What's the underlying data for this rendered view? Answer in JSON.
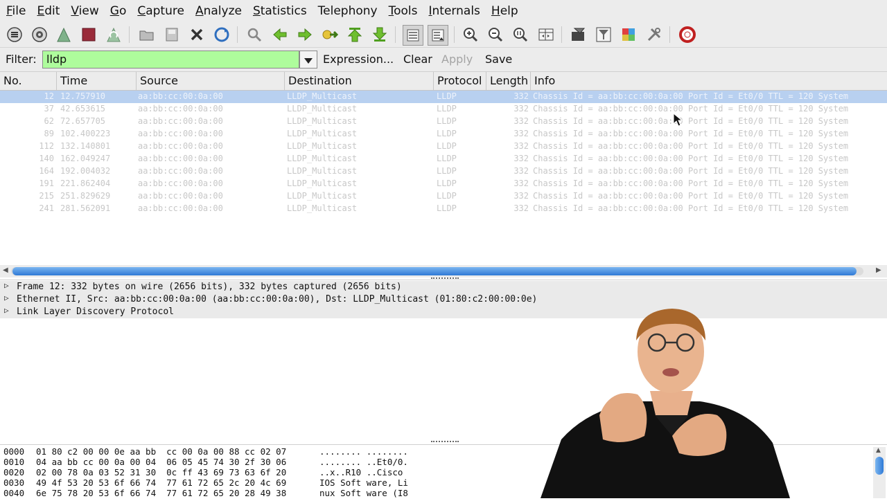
{
  "menu": [
    {
      "ul": "F",
      "rest": "ile"
    },
    {
      "ul": "E",
      "rest": "dit"
    },
    {
      "ul": "V",
      "rest": "iew"
    },
    {
      "ul": "G",
      "rest": "o"
    },
    {
      "ul": "C",
      "rest": "apture"
    },
    {
      "ul": "A",
      "rest": "nalyze"
    },
    {
      "ul": "S",
      "rest": "tatistics"
    },
    {
      "ul": "",
      "rest": "Telephony"
    },
    {
      "ul": "T",
      "rest": "ools"
    },
    {
      "ul": "I",
      "rest": "nternals"
    },
    {
      "ul": "H",
      "rest": "elp"
    }
  ],
  "toolbar": {
    "icons": [
      "interfaces-icon",
      "options-icon",
      "start-capture-icon",
      "stop-capture-icon",
      "restart-capture-icon",
      "open-file-icon",
      "save-file-icon",
      "close-file-icon",
      "reload-icon",
      "find-packet-icon",
      "go-back-icon",
      "go-forward-icon",
      "go-to-packet-icon",
      "go-first-icon",
      "go-last-icon",
      "colorize-icon",
      "auto-scroll-icon",
      "zoom-in-icon",
      "zoom-out-icon",
      "zoom-normal-icon",
      "resize-columns-icon",
      "capture-filters-icon",
      "display-filters-icon",
      "coloring-rules-icon",
      "preferences-icon",
      "help-icon"
    ]
  },
  "filter": {
    "label": "Filter:",
    "value": "lldp",
    "expression": "Expression...",
    "clear": "Clear",
    "apply": "Apply",
    "save": "Save"
  },
  "columns": [
    "No.",
    "Time",
    "Source",
    "Destination",
    "Protocol",
    "Length",
    "Info"
  ],
  "packets": [
    {
      "no": "12",
      "time": "12.757910",
      "src": "aa:bb:cc:00:0a:00",
      "dst": "LLDP_Multicast",
      "proto": "LLDP",
      "len": "332",
      "info": "Chassis Id = aa:bb:cc:00:0a:00 Port Id = Et0/0 TTL = 120 System",
      "selected": true
    },
    {
      "no": "37",
      "time": "42.653615",
      "src": "aa:bb:cc:00:0a:00",
      "dst": "LLDP_Multicast",
      "proto": "LLDP",
      "len": "332",
      "info": "Chassis Id = aa:bb:cc:00:0a:00 Port Id = Et0/0 TTL = 120 System"
    },
    {
      "no": "62",
      "time": "72.657705",
      "src": "aa:bb:cc:00:0a:00",
      "dst": "LLDP_Multicast",
      "proto": "LLDP",
      "len": "332",
      "info": "Chassis Id = aa:bb:cc:00:0a:00 Port Id = Et0/0 TTL = 120 System"
    },
    {
      "no": "89",
      "time": "102.400223",
      "src": "aa:bb:cc:00:0a:00",
      "dst": "LLDP_Multicast",
      "proto": "LLDP",
      "len": "332",
      "info": "Chassis Id = aa:bb:cc:00:0a:00 Port Id = Et0/0 TTL = 120 System"
    },
    {
      "no": "112",
      "time": "132.140801",
      "src": "aa:bb:cc:00:0a:00",
      "dst": "LLDP_Multicast",
      "proto": "LLDP",
      "len": "332",
      "info": "Chassis Id = aa:bb:cc:00:0a:00 Port Id = Et0/0 TTL = 120 System"
    },
    {
      "no": "140",
      "time": "162.049247",
      "src": "aa:bb:cc:00:0a:00",
      "dst": "LLDP_Multicast",
      "proto": "LLDP",
      "len": "332",
      "info": "Chassis Id = aa:bb:cc:00:0a:00 Port Id = Et0/0 TTL = 120 System"
    },
    {
      "no": "164",
      "time": "192.004032",
      "src": "aa:bb:cc:00:0a:00",
      "dst": "LLDP_Multicast",
      "proto": "LLDP",
      "len": "332",
      "info": "Chassis Id = aa:bb:cc:00:0a:00 Port Id = Et0/0 TTL = 120 System"
    },
    {
      "no": "191",
      "time": "221.862404",
      "src": "aa:bb:cc:00:0a:00",
      "dst": "LLDP_Multicast",
      "proto": "LLDP",
      "len": "332",
      "info": "Chassis Id = aa:bb:cc:00:0a:00 Port Id = Et0/0 TTL = 120 System"
    },
    {
      "no": "215",
      "time": "251.829629",
      "src": "aa:bb:cc:00:0a:00",
      "dst": "LLDP_Multicast",
      "proto": "LLDP",
      "len": "332",
      "info": "Chassis Id = aa:bb:cc:00:0a:00 Port Id = Et0/0 TTL = 120 System"
    },
    {
      "no": "241",
      "time": "281.562091",
      "src": "aa:bb:cc:00:0a:00",
      "dst": "LLDP_Multicast",
      "proto": "LLDP",
      "len": "332",
      "info": "Chassis Id = aa:bb:cc:00:0a:00 Port Id = Et0/0 TTL = 120 System"
    }
  ],
  "details": [
    "Frame 12: 332 bytes on wire (2656 bits), 332 bytes captured (2656 bits)",
    "Ethernet II, Src: aa:bb:cc:00:0a:00 (aa:bb:cc:00:0a:00), Dst: LLDP_Multicast (01:80:c2:00:00:0e)",
    "Link Layer Discovery Protocol"
  ],
  "hex": [
    {
      "offset": "0000",
      "bytes": "01 80 c2 00 00 0e aa bb  cc 00 0a 00 88 cc 02 07",
      "ascii": "........ ........"
    },
    {
      "offset": "0010",
      "bytes": "04 aa bb cc 00 0a 00 04  06 05 45 74 30 2f 30 06",
      "ascii": "........ ..Et0/0."
    },
    {
      "offset": "0020",
      "bytes": "02 00 78 0a 03 52 31 30  0c ff 43 69 73 63 6f 20",
      "ascii": "..x..R10 ..Cisco "
    },
    {
      "offset": "0030",
      "bytes": "49 4f 53 20 53 6f 66 74  77 61 72 65 2c 20 4c 69",
      "ascii": "IOS Soft ware, Li"
    },
    {
      "offset": "0040",
      "bytes": "6e 75 78 20 53 6f 66 74  77 61 72 65 20 28 49 38",
      "ascii": "nux Soft ware (I8"
    }
  ],
  "colors": {
    "filter_bg": "#aefc9c",
    "selected_row": "#b8d0f0",
    "scroll_thumb": "#2f7ad6"
  }
}
